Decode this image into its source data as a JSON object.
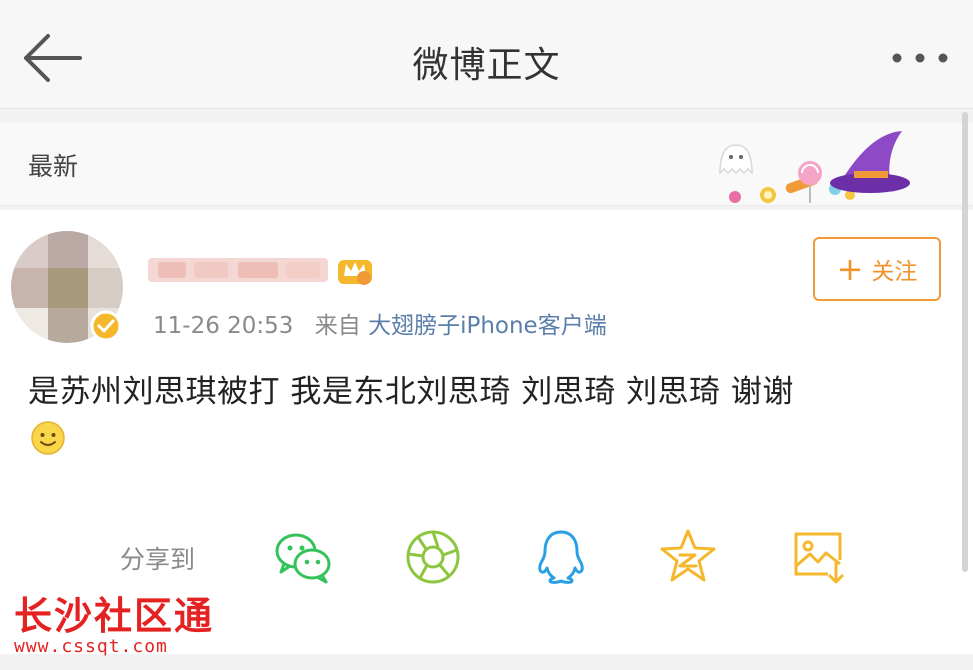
{
  "nav": {
    "title": "微博正文"
  },
  "latest": {
    "label": "最新"
  },
  "post": {
    "time": "11-26 20:53",
    "from_prefix": "来自",
    "source": "大翅膀子iPhone客户端",
    "text": "是苏州刘思琪被打 我是东北刘思琦 刘思琦 刘思琦 谢谢",
    "follow_label": "关注"
  },
  "share": {
    "label": "分享到",
    "targets": [
      "wechat-icon",
      "moments-icon",
      "qq-icon",
      "qzone-icon",
      "save-image-icon"
    ]
  },
  "watermark": {
    "title": "长沙社区通",
    "url": "www.cssqt.com"
  },
  "colors": {
    "accent_orange": "#f0932b",
    "wechat_green": "#35c25a",
    "moments_green": "#8cc63f",
    "qq_blue": "#2a9fe4",
    "qzone_yellow": "#f5b72b",
    "link_blue": "#5b7eab",
    "watermark_red": "#e52222"
  }
}
